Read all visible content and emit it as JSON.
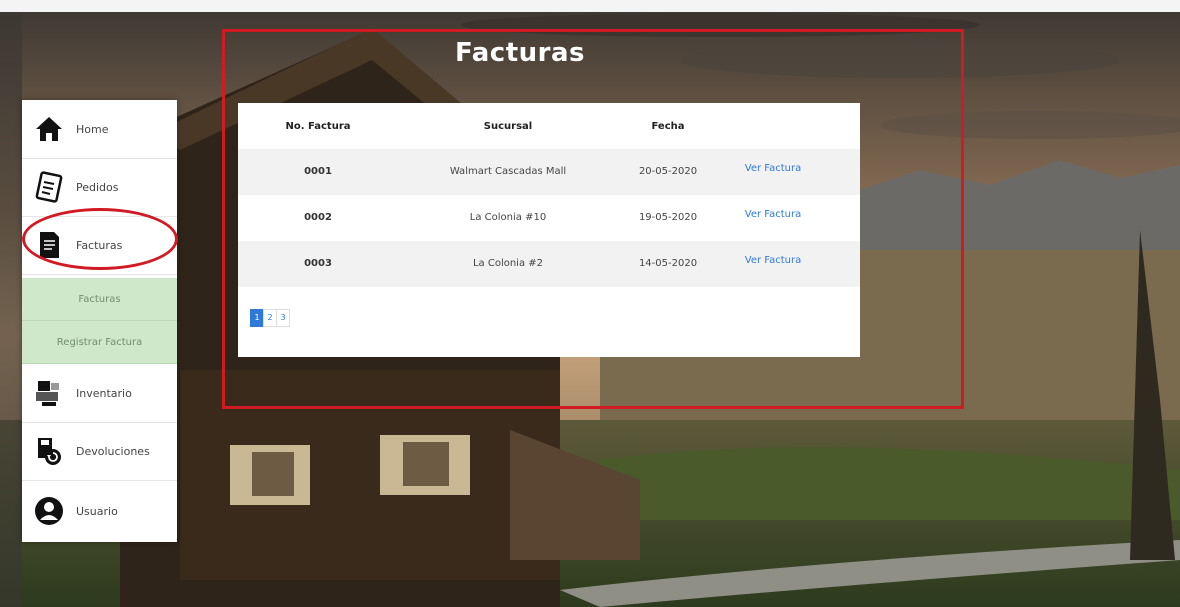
{
  "title": "Facturas",
  "nav": {
    "home": "Home",
    "pedidos": "Pedidos",
    "facturas": "Facturas",
    "sub_facturas": "Facturas",
    "sub_registrar": "Registrar Factura",
    "inventario": "Inventario",
    "devoluciones": "Devoluciones",
    "usuario": "Usuario"
  },
  "table": {
    "headers": [
      "No. Factura",
      "Sucursal",
      "Fecha"
    ],
    "rows": [
      {
        "num": "0001",
        "sucursal": "Walmart Cascadas Mall",
        "fecha": "20-05-2020",
        "link": "Ver Factura"
      },
      {
        "num": "0002",
        "sucursal": "La Colonia #10",
        "fecha": "19-05-2020",
        "link": "Ver Factura"
      },
      {
        "num": "0003",
        "sucursal": "La Colonia #2",
        "fecha": "14-05-2020",
        "link": "Ver Factura"
      }
    ]
  },
  "pager": [
    "1",
    "2",
    "3"
  ],
  "colors": {
    "accent": "#2f7ad8",
    "annotation": "#d11a24",
    "submenu": "#cfe8c9"
  }
}
